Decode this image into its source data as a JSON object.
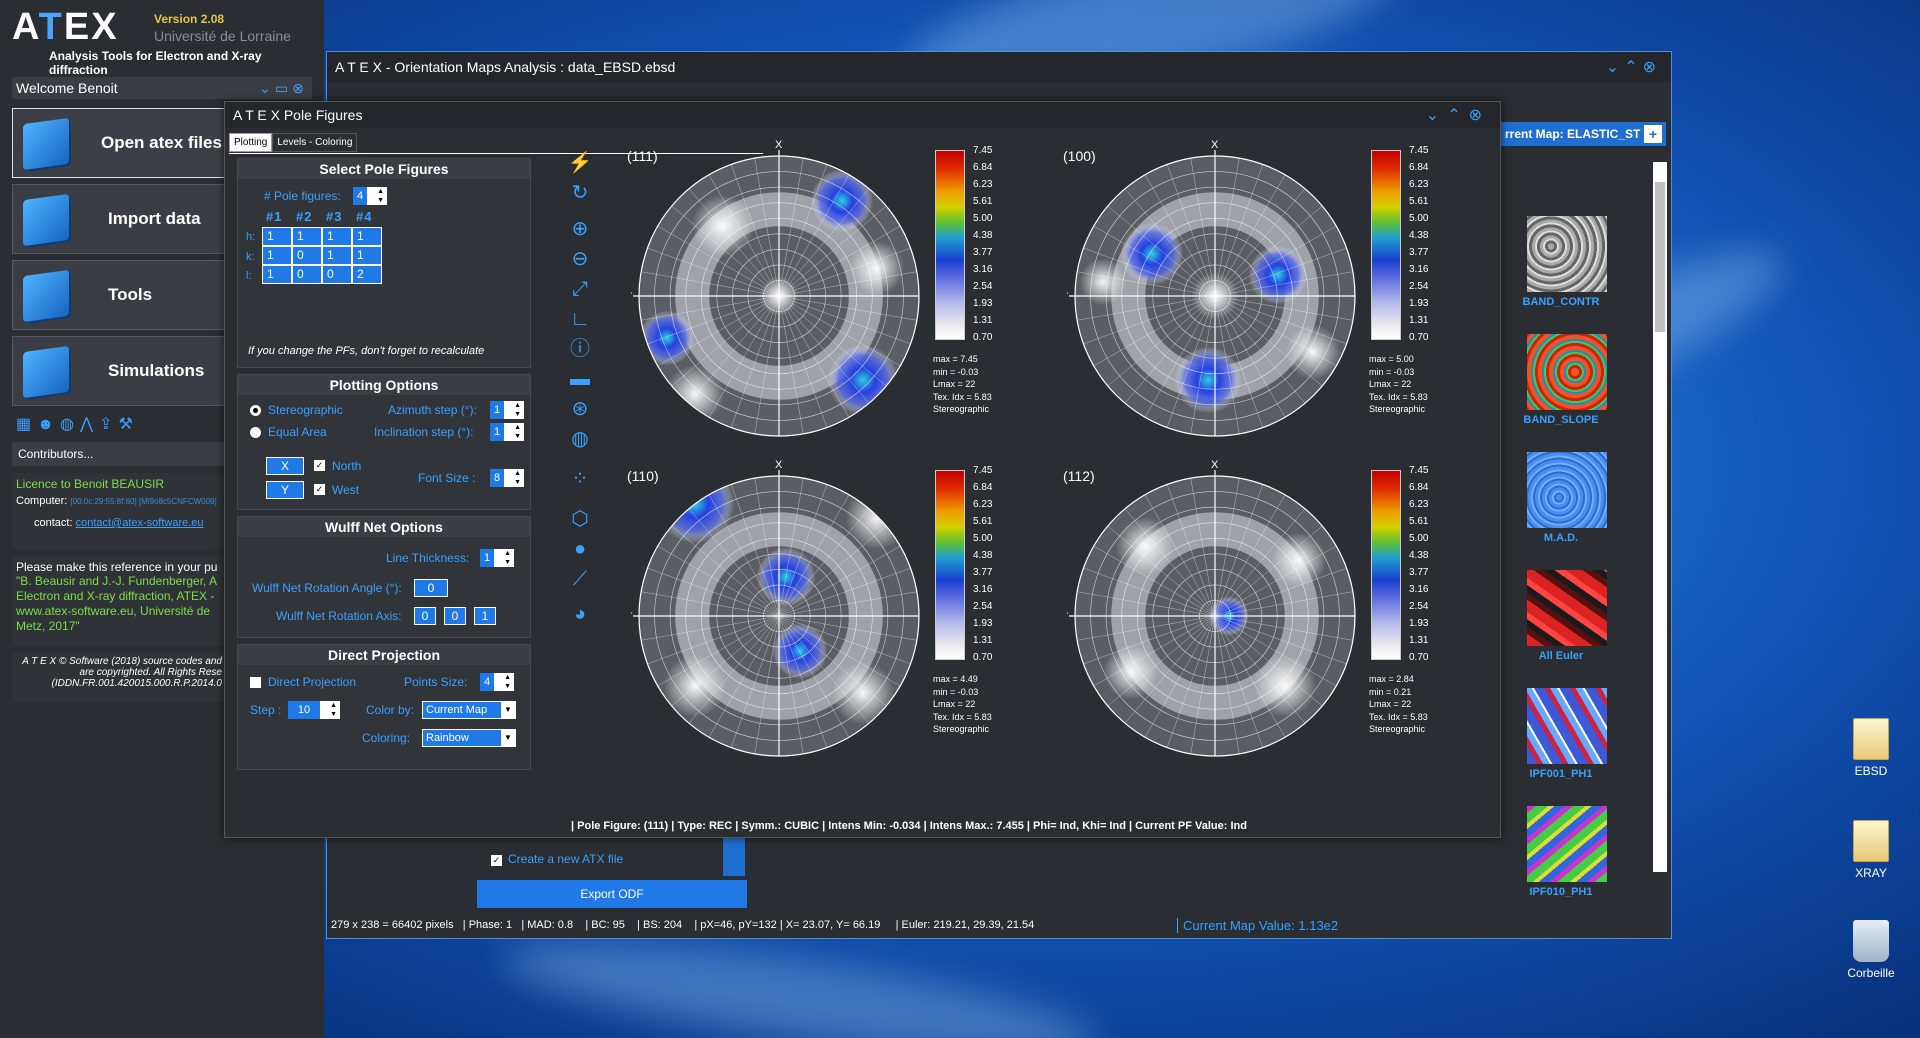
{
  "launcher": {
    "brand": {
      "logo": "ATEX",
      "version": "Version 2.08",
      "university": "Université de Lorraine",
      "tagline": "Analysis Tools for Electron and X-ray diffraction"
    },
    "welcome": "Welcome Benoit",
    "menu": [
      {
        "label": "Open atex files",
        "icon": "open-folder-icon"
      },
      {
        "label": "Import data",
        "icon": "import-icon"
      },
      {
        "label": "Tools",
        "icon": "toolbox-icon"
      },
      {
        "label": "Simulations",
        "icon": "monitor-icon"
      }
    ],
    "contributors": "Contributors...",
    "licence": "Licence to Benoit BEAUSIR",
    "computer_label": "Computer:",
    "computer_value": "[00:0c:29:55:8f:60] [Mi9o8c5CNFCW009]",
    "contact_label": "contact:",
    "contact_value": "contact@atex-software.eu",
    "reference_intro": "Please make this reference in your pu",
    "reference_text": "\"B. Beausir and J.-J. Fundenberger, A Electron and X-ray diffraction, ATEX - www.atex-software.eu, Université de Metz, 2017\"",
    "copyright": "A T E X © Software (2018) source codes and are copyrighted. All Rights Rese (IDDN.FR.001.420015.000.R.P.2014.0"
  },
  "om_window": {
    "title": "A T E X - Orientation Maps Analysis : data_EBSD.ebsd",
    "current_map": "rrent Map: ELASTIC_ST",
    "thumbnails": [
      "BAND_CONTR",
      "BAND_SLOPE",
      "M.A.D.",
      "All Euler",
      "IPF001_PH1",
      "IPF010_PH1"
    ],
    "create_atx": "Create a new ATX file",
    "export_button": "Export ODF",
    "status": {
      "pixels": "279 x 238 = 66402 pixels",
      "phase": "| Phase: 1",
      "mad": "| MAD: 0.8",
      "bc": "| BC: 95",
      "bs": "| BS: 204",
      "pxy": "| pX=46, pY=132",
      "xy": "| X= 23.07, Y= 66.19",
      "euler": "| Euler: 219.21, 29.39, 21.54",
      "current_value": "Current Map Value: 1.13e2"
    }
  },
  "pf_window": {
    "title": "A T E X  Pole Figures",
    "tabs": [
      "Plotting",
      "Levels - Coloring"
    ],
    "select": {
      "header": "Select Pole Figures",
      "num_label": "# Pole figures:",
      "num_value": "4",
      "columns": [
        "#1",
        "#2",
        "#3",
        "#4"
      ],
      "rows": [
        {
          "label": "h:",
          "values": [
            "1",
            "1",
            "1",
            "1"
          ]
        },
        {
          "label": "k:",
          "values": [
            "1",
            "0",
            "1",
            "1"
          ]
        },
        {
          "label": "l:",
          "values": [
            "1",
            "0",
            "0",
            "2"
          ]
        }
      ],
      "note": "If you change the PFs, don't forget to recalculate"
    },
    "plotting": {
      "header": "Plotting Options",
      "stereo": "Stereographic",
      "equal_area": "Equal Area",
      "azimuth_label": "Azimuth step (°):",
      "azimuth_value": "1",
      "incl_label": "Inclination step (°):",
      "incl_value": "1",
      "x_btn": "X",
      "y_btn": "Y",
      "north": "North",
      "west": "West",
      "font_label": "Font Size :",
      "font_value": "8"
    },
    "wulff": {
      "header": "Wulff Net Options",
      "thick_label": "Line Thickness:",
      "thick_value": "1",
      "angle_label": "Wulff Net Rotation Angle (°):",
      "angle_value": "0",
      "axis_label": "Wulff Net Rotation Axis:",
      "axis_values": [
        "0",
        "0",
        "1"
      ]
    },
    "direct": {
      "header": "Direct Projection",
      "dp_label": "Direct Projection",
      "points_label": "Points Size:",
      "points_value": "4",
      "step_label": "Step :",
      "step_value": "10",
      "colorby_label": "Color by:",
      "colorby_value": "Current Map",
      "coloring_label": "Coloring:",
      "coloring_value": "Rainbow"
    },
    "colorbar_ticks": [
      "7.45",
      "6.84",
      "6.23",
      "5.61",
      "5.00",
      "4.38",
      "3.77",
      "3.16",
      "2.54",
      "1.93",
      "1.31",
      "0.70"
    ],
    "figures": [
      {
        "label": "(111)",
        "stats": "max = 7.45\nmin = -0.03\nLmax = 22\nTex. Idx = 5.83\nStereographic"
      },
      {
        "label": "(100)",
        "stats": "max = 5.00\nmin = -0.03\nLmax = 22\nTex. Idx = 5.83\nStereographic"
      },
      {
        "label": "(110)",
        "stats": "max = 4.49\nmin = -0.03\nLmax = 22\nTex. Idx = 5.83\nStereographic"
      },
      {
        "label": "(112)",
        "stats": "max = 2.84\nmin = 0.21\nLmax = 22\nTex. Idx = 5.83\nStereographic"
      }
    ],
    "axis_x": "X",
    "axis_y": "Y",
    "status": "| Pole Figure: (111) | Type: REC | Symm.: CUBIC | Intens Min: -0.034 | Intens Max.: 7.455 | Phi= Ind, Khi= Ind | Current PF Value: Ind"
  },
  "desktop": {
    "icons": [
      "EBSD",
      "XRAY",
      "Corbeille"
    ]
  },
  "colors": {
    "accent": "#1f7ae8",
    "panel": "#2a2d31",
    "link": "#3aa0ff",
    "licence": "#7dde4a"
  }
}
